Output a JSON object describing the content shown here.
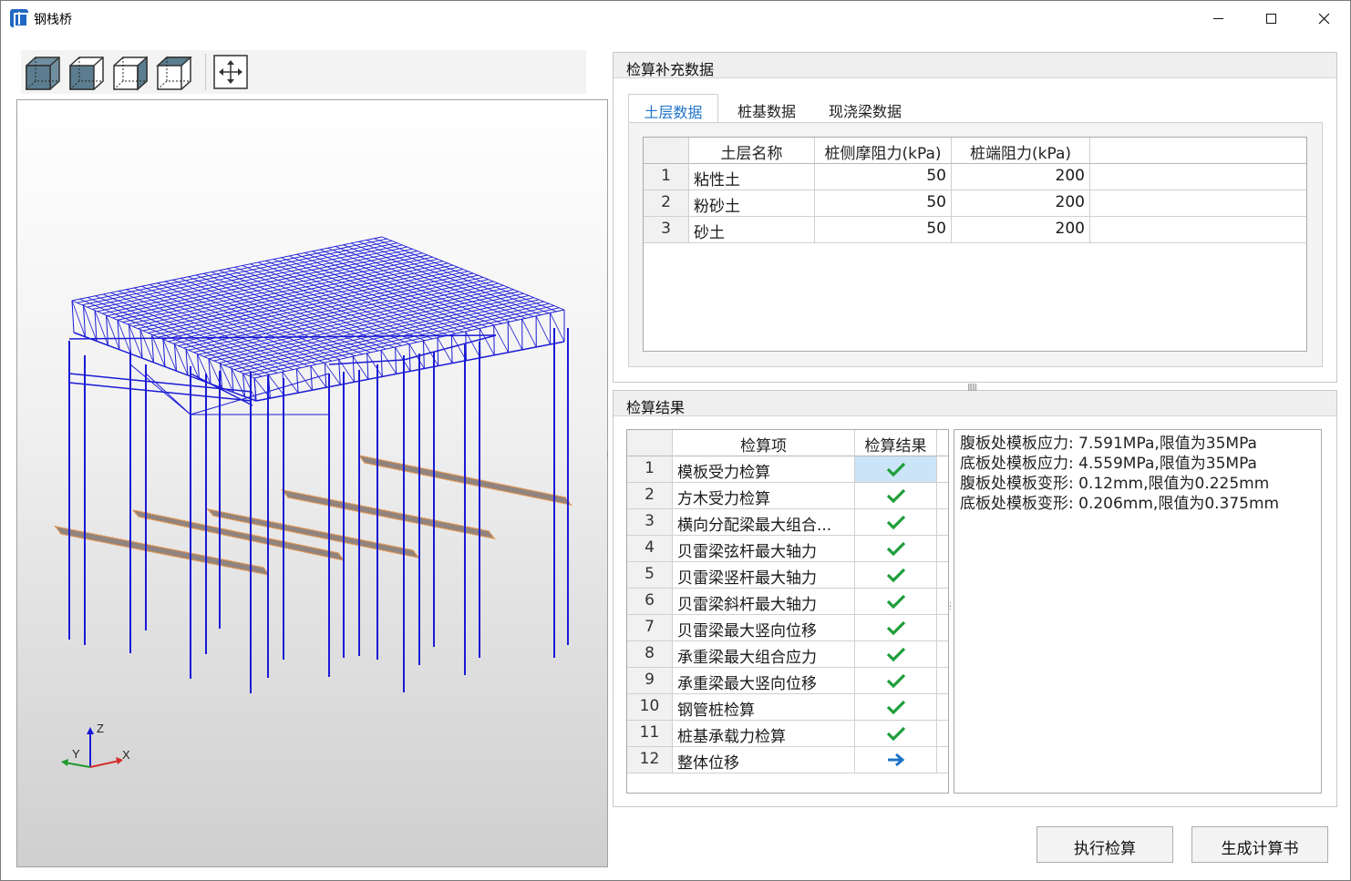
{
  "window": {
    "title": "钢栈桥",
    "controls": {
      "minimize": "minimize-icon",
      "maximize": "maximize-icon",
      "close": "close-icon"
    }
  },
  "toolbar": {
    "buttons": [
      {
        "icon": "view-iso-1-icon"
      },
      {
        "icon": "view-iso-2-icon"
      },
      {
        "icon": "view-iso-3-icon"
      },
      {
        "icon": "view-iso-4-icon"
      },
      {
        "icon": "fit-view-icon"
      }
    ]
  },
  "viewport": {
    "axes": {
      "z": "Z",
      "y": "Y",
      "x": "X"
    },
    "colors": {
      "structure": "#1a1ad6",
      "footing": "#8f8480",
      "footing_edge": "#e08a3c"
    }
  },
  "supplement": {
    "title": "检算补充数据",
    "tabs": [
      "土层数据",
      "桩基数据",
      "现浇梁数据"
    ],
    "active_tab": 0,
    "soil_table": {
      "columns": [
        "土层名称",
        "桩侧摩阻力(kPa)",
        "桩端阻力(kPa)"
      ],
      "rows": [
        {
          "index": "1",
          "name": "粘性土",
          "side_friction": "50",
          "end_resistance": "200"
        },
        {
          "index": "2",
          "name": "粉砂土",
          "side_friction": "50",
          "end_resistance": "200"
        },
        {
          "index": "3",
          "name": "砂土",
          "side_friction": "50",
          "end_resistance": "200"
        }
      ]
    }
  },
  "results": {
    "title": "检算结果",
    "columns": [
      "检算项",
      "检算结果"
    ],
    "rows": [
      {
        "index": "1",
        "item": "模板受力检算",
        "status": "pass"
      },
      {
        "index": "2",
        "item": "方木受力检算",
        "status": "pass"
      },
      {
        "index": "3",
        "item": "横向分配梁最大组合...",
        "status": "pass"
      },
      {
        "index": "4",
        "item": "贝雷梁弦杆最大轴力",
        "status": "pass"
      },
      {
        "index": "5",
        "item": "贝雷梁竖杆最大轴力",
        "status": "pass"
      },
      {
        "index": "6",
        "item": "贝雷梁斜杆最大轴力",
        "status": "pass"
      },
      {
        "index": "7",
        "item": "贝雷梁最大竖向位移",
        "status": "pass"
      },
      {
        "index": "8",
        "item": "承重梁最大组合应力",
        "status": "pass"
      },
      {
        "index": "9",
        "item": "承重梁最大竖向位移",
        "status": "pass"
      },
      {
        "index": "10",
        "item": "钢管桩检算",
        "status": "pass"
      },
      {
        "index": "11",
        "item": "桩基承载力检算",
        "status": "pass"
      },
      {
        "index": "12",
        "item": "整体位移",
        "status": "pending"
      }
    ],
    "selected_row": 0,
    "detail_lines": [
      "腹板处模板应力: 7.591MPa,限值为35MPa",
      "底板处模板应力: 4.559MPa,限值为35MPa",
      "腹板处模板变形: 0.12mm,限值为0.225mm",
      "底板处模板变形: 0.206mm,限值为0.375mm"
    ],
    "colors": {
      "pass": "#1e9e3a",
      "pending": "#1e74c7",
      "selected": "#cce4f7"
    }
  },
  "actions": {
    "run_check": "执行检算",
    "generate_report": "生成计算书"
  }
}
